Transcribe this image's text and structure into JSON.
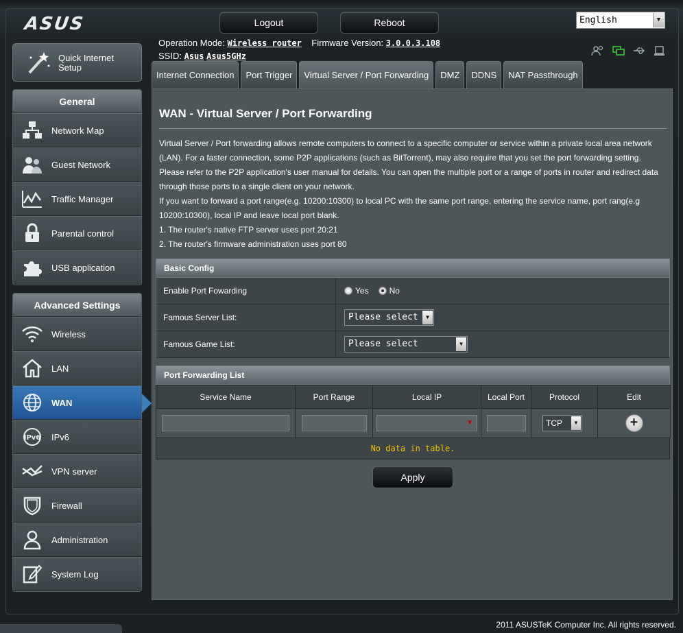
{
  "header": {
    "logo": "ASUS",
    "logout_label": "Logout",
    "reboot_label": "Reboot",
    "language": "English",
    "operation_mode_label": "Operation Mode:",
    "operation_mode_value": "Wireless router",
    "firmware_label": "Firmware Version:",
    "firmware_value": "3.0.0.3.108",
    "ssid_label": "SSID:",
    "ssid_1": "Asus",
    "ssid_2": "Asus5GHz"
  },
  "sidebar": {
    "quick_setup_line1": "Quick Internet",
    "quick_setup_line2": "Setup",
    "general_title": "General",
    "general_items": [
      {
        "label": "Network Map",
        "icon": "network-map-icon"
      },
      {
        "label": "Guest Network",
        "icon": "guest-network-icon"
      },
      {
        "label": "Traffic Manager",
        "icon": "traffic-manager-icon"
      },
      {
        "label": "Parental control",
        "icon": "lock-icon"
      },
      {
        "label": "USB application",
        "icon": "puzzle-icon"
      }
    ],
    "advanced_title": "Advanced Settings",
    "advanced_items": [
      {
        "label": "Wireless",
        "icon": "wifi-icon"
      },
      {
        "label": "LAN",
        "icon": "house-icon"
      },
      {
        "label": "WAN",
        "icon": "globe-icon",
        "active": true
      },
      {
        "label": "IPv6",
        "icon": "ipv6-icon"
      },
      {
        "label": "VPN server",
        "icon": "vpn-icon"
      },
      {
        "label": "Firewall",
        "icon": "shield-icon"
      },
      {
        "label": "Administration",
        "icon": "user-icon"
      },
      {
        "label": "System Log",
        "icon": "log-icon"
      }
    ]
  },
  "tabs": [
    {
      "label": "Internet Connection"
    },
    {
      "label": "Port Trigger"
    },
    {
      "label": "Virtual Server / Port Forwarding",
      "active": true
    },
    {
      "label": "DMZ"
    },
    {
      "label": "DDNS"
    },
    {
      "label": "NAT Passthrough"
    }
  ],
  "main": {
    "title": "WAN - Virtual Server / Port Forwarding",
    "desc_1": "Virtual Server / Port forwarding allows remote computers to connect to a specific computer or service within a private local area network (LAN). For a faster connection, some P2P applications (such as BitTorrent), may also require that you set the port forwarding setting. Please refer to the P2P application's user manual for details. You can open the multiple port or a range of ports in router and redirect data through those ports to a single client on your network.",
    "desc_2": "If you want to forward a port range(e.g. 10200:10300) to local PC with the same port range, entering the service name, port rang(e.g 10200:10300), local IP and leave local port blank.",
    "desc_3": "1. The router's native FTP server uses port 20:21",
    "desc_4": "2. The router's firmware administration uses port 80",
    "basic_config": {
      "title": "Basic Config",
      "enable_label": "Enable Port Fowarding",
      "yes_label": "Yes",
      "no_label": "No",
      "enabled": "No",
      "server_list_label": "Famous Server List:",
      "server_list_value": "Please select",
      "game_list_label": "Famous Game List:",
      "game_list_value": "Please select"
    },
    "pf_list": {
      "title": "Port Forwarding List",
      "columns": [
        "Service Name",
        "Port Range",
        "Local IP",
        "Local Port",
        "Protocol",
        "Edit"
      ],
      "protocol_value": "TCP",
      "empty_text": "No data in table."
    },
    "apply_label": "Apply"
  },
  "footer": {
    "copyright": "2011 ASUSTeK Computer Inc. All rights reserved."
  },
  "colors": {
    "active_nav": "#2a66a8",
    "nodata_text": "#f2c200",
    "panel": "#4d5659"
  }
}
